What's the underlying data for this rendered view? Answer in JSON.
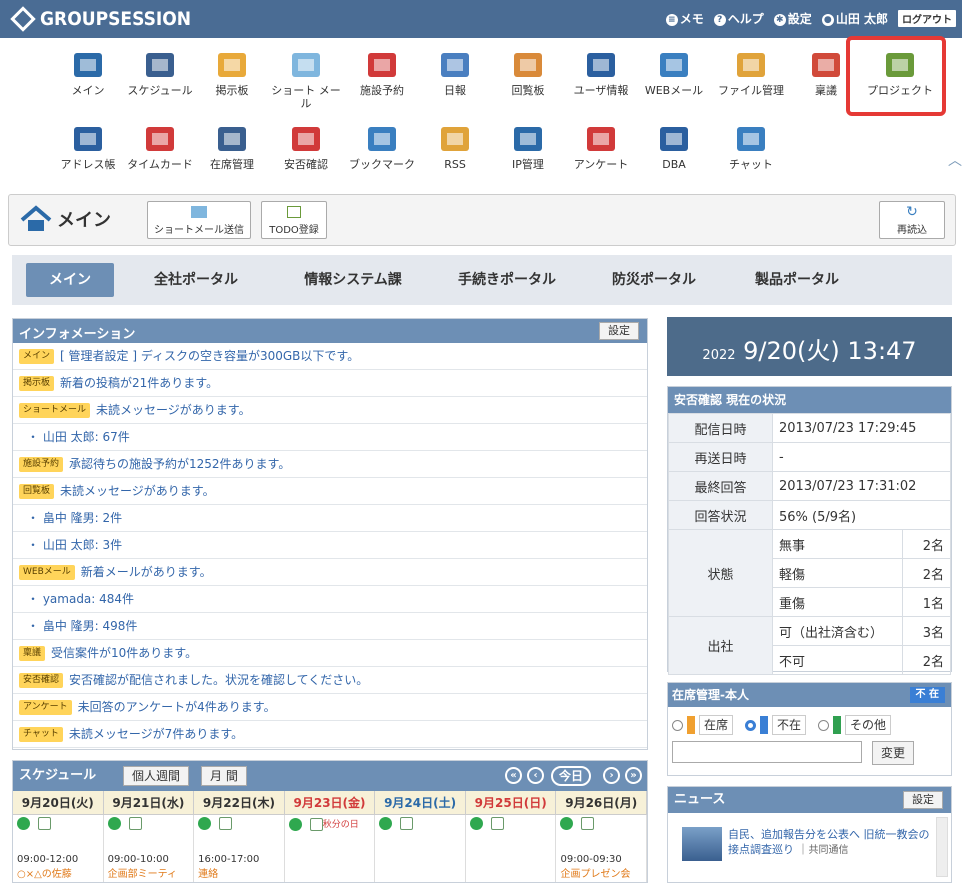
{
  "topbar": {
    "logo": "GROUPSESSION",
    "memo": "メモ",
    "help": "ヘルプ",
    "settings": "設定",
    "user": "山田 太郎",
    "logout": "ログアウト"
  },
  "apps": [
    {
      "label": "メイン",
      "icon": "house-icon",
      "color": "#2b6aa8"
    },
    {
      "label": "スケジュール",
      "icon": "calendar-icon",
      "color": "#3a5f8f"
    },
    {
      "label": "掲示板",
      "icon": "board-icon",
      "color": "#e8a93a"
    },
    {
      "label": "ショート メール",
      "icon": "envelope-icon",
      "color": "#7fb6de"
    },
    {
      "label": "施設予約",
      "icon": "facility-icon",
      "color": "#d13a3a"
    },
    {
      "label": "日報",
      "icon": "report-icon",
      "color": "#4a7fc0"
    },
    {
      "label": "回覧板",
      "icon": "circular-icon",
      "color": "#d98a3a"
    },
    {
      "label": "ユーザ情報",
      "icon": "user-info-icon",
      "color": "#2b5f9f"
    },
    {
      "label": "WEBメール",
      "icon": "webmail-icon",
      "color": "#3a7fc0"
    },
    {
      "label": "ファイル管理",
      "icon": "folder-icon",
      "color": "#e0a33a"
    },
    {
      "label": "稟議",
      "icon": "approval-icon",
      "color": "#d14a3a"
    },
    {
      "label": "プロジェクト",
      "icon": "project-icon",
      "color": "#6a9a3a"
    },
    {
      "label": "アドレス帳",
      "icon": "address-book-icon",
      "color": "#2b5f9f"
    },
    {
      "label": "タイムカード",
      "icon": "timecard-icon",
      "color": "#d13a3a"
    },
    {
      "label": "在席管理",
      "icon": "seat-icon",
      "color": "#3a5f8f"
    },
    {
      "label": "安否確認",
      "icon": "safety-icon",
      "color": "#d13a3a"
    },
    {
      "label": "ブックマーク",
      "icon": "bookmark-icon",
      "color": "#3a7fc0"
    },
    {
      "label": "RSS",
      "icon": "rss-icon",
      "color": "#e0a33a"
    },
    {
      "label": "IP管理",
      "icon": "ip-icon",
      "color": "#2b6aa8"
    },
    {
      "label": "アンケート",
      "icon": "survey-icon",
      "color": "#d13a3a"
    },
    {
      "label": "DBA",
      "icon": "database-icon",
      "color": "#2b5f9f"
    },
    {
      "label": "チャット",
      "icon": "chat-icon",
      "color": "#3a7fc0"
    }
  ],
  "main": {
    "title": "メイン",
    "smail_btn": "ショートメール送信",
    "todo_btn": "TODO登録",
    "reload_btn": "再読込"
  },
  "tabs": [
    "メイン",
    "全社ポータル",
    "情報システム課",
    "手続きポータル",
    "防災ポータル",
    "製品ポータル"
  ],
  "info": {
    "title": "インフォメーション",
    "settings": "設定",
    "rows": [
      {
        "tag": "メイン",
        "text": "[ 管理者設定 ] ディスクの空き容量が300GB以下です。"
      },
      {
        "tag": "掲示板",
        "text": "新着の投稿が21件あります。"
      },
      {
        "tag": "ショートメール",
        "text": "未読メッセージがあります。"
      },
      {
        "tag": "",
        "text": "・ 山田 太郎: 67件"
      },
      {
        "tag": "施設予約",
        "text": "承認待ちの施設予約が1252件あります。"
      },
      {
        "tag": "回覧板",
        "text": "未読メッセージがあります。"
      },
      {
        "tag": "",
        "text": "・ 畠中 隆男: 2件"
      },
      {
        "tag": "",
        "text": "・ 山田 太郎: 3件"
      },
      {
        "tag": "WEBメール",
        "text": "新着メールがあります。"
      },
      {
        "tag": "",
        "text": "・ yamada: 484件"
      },
      {
        "tag": "",
        "text": "・ 畠中 隆男: 498件"
      },
      {
        "tag": "稟議",
        "text": "受信案件が10件あります。"
      },
      {
        "tag": "安否確認",
        "text": "安否確認が配信されました。状況を確認してください。"
      },
      {
        "tag": "アンケート",
        "text": "未回答のアンケートが4件あります。"
      },
      {
        "tag": "チャット",
        "text": "未読メッセージが7件あります。"
      }
    ]
  },
  "clock": {
    "year": "2022",
    "date": "9/20(火) 13:47"
  },
  "anpi": {
    "title": "安否確認 現在の状況",
    "rows": [
      {
        "label": "配信日時",
        "value": "2013/07/23 17:29:45"
      },
      {
        "label": "再送日時",
        "value": "-"
      },
      {
        "label": "最終回答",
        "value": "2013/07/23 17:31:02"
      },
      {
        "label": "回答状況",
        "value": "56% (5/9名)"
      }
    ],
    "state_label": "状態",
    "states": [
      {
        "name": "無事",
        "count": "2名"
      },
      {
        "name": "軽傷",
        "count": "2名"
      },
      {
        "name": "重傷",
        "count": "1名"
      }
    ],
    "work_label": "出社",
    "works": [
      {
        "name": "可（出社済含む）",
        "count": "3名"
      },
      {
        "name": "不可",
        "count": "2名"
      }
    ]
  },
  "zaiseki": {
    "title": "在席管理-本人",
    "badge": "不 在",
    "opt1": "在席",
    "opt2": "不在",
    "opt3": "その他",
    "change": "変更",
    "input": ""
  },
  "news": {
    "title": "ニュース",
    "settings": "設定",
    "item": "自民、追加報告分を公表へ 旧統一教会の接点調査巡り",
    "source": "共同通信"
  },
  "schedule": {
    "title": "スケジュール",
    "week": "個人週間",
    "month": "月 間",
    "today": "今日",
    "days": [
      {
        "label": "9月20日(火)",
        "color": "#333"
      },
      {
        "label": "9月21日(水)",
        "color": "#333"
      },
      {
        "label": "9月22日(木)",
        "color": "#333"
      },
      {
        "label": "9月23日(金)",
        "color": "#d13a3a"
      },
      {
        "label": "9月24日(土)",
        "color": "#2b6aa8"
      },
      {
        "label": "9月25日(日)",
        "color": "#d13a3a"
      },
      {
        "label": "9月26日(月)",
        "color": "#333"
      }
    ],
    "events": [
      {
        "time": "09:00-12:00",
        "title": "○×△の佐藤"
      },
      {
        "time": "09:00-10:00",
        "title": "企画部ミーティ"
      },
      {
        "time": "16:00-17:00",
        "title": "連絡"
      },
      {
        "time": "",
        "title": "秋分の日"
      },
      {
        "time": "",
        "title": ""
      },
      {
        "time": "",
        "title": ""
      },
      {
        "time": "09:00-09:30",
        "title": "企画プレゼン会"
      }
    ]
  }
}
